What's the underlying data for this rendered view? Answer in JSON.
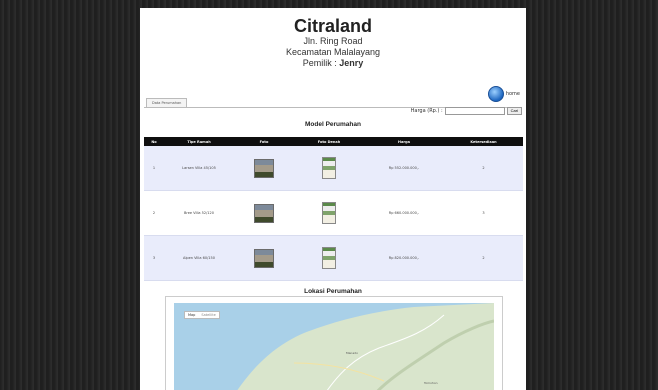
{
  "header": {
    "title": "Citraland",
    "address1": "Jln. Ring Road",
    "address2": "Kecamatan Malalayang",
    "owner_label": "Pemilik : ",
    "owner_name": "Jenry"
  },
  "home": {
    "label": "home"
  },
  "tabs": [
    {
      "label": "Data Perumahan"
    }
  ],
  "search": {
    "label": "Harga (Rp.) :",
    "value": "",
    "button": "Cari"
  },
  "section_models": "Model Perumahan",
  "table": {
    "headers": [
      "No",
      "Tipe Rumah",
      "Foto",
      "Foto Denah",
      "Harga",
      "Ketersediaan"
    ],
    "rows": [
      {
        "no": "1",
        "tipe": "Larsen Villa 45/105",
        "harga": "Rp 552.000.000,-",
        "stok": "2"
      },
      {
        "no": "2",
        "tipe": "Bree Villa 52/120",
        "harga": "Rp 660.000.000,-",
        "stok": "3"
      },
      {
        "no": "3",
        "tipe": "Alpen Villa 60/150",
        "harga": "Rp 820.000.000,-",
        "stok": "2"
      }
    ]
  },
  "section_location": "Lokasi Perumahan",
  "map": {
    "btn_map": "Map",
    "btn_sat": "Satellite",
    "place1": "Manado",
    "place2": "Tomohon"
  },
  "colors": {
    "header_row": "#0f0f0f",
    "row_bg": "#e9ecfb",
    "sea": "#a9d0e8",
    "land": "#d9e5cc"
  }
}
